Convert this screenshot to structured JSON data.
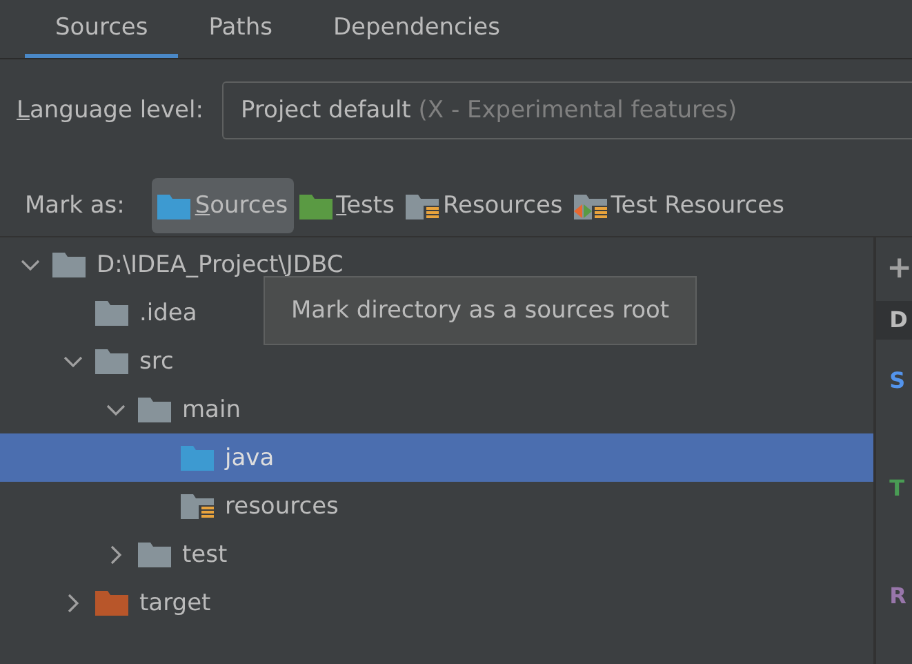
{
  "tabs": [
    {
      "label": "Sources",
      "selected": true
    },
    {
      "label": "Paths",
      "selected": false
    },
    {
      "label": "Dependencies",
      "selected": false
    }
  ],
  "language_level": {
    "label": "Language level:",
    "mnemonic": true,
    "value": "Project default",
    "hint": "(X - Experimental features)"
  },
  "mark_as": {
    "label": "Mark as:",
    "buttons": [
      {
        "label": "Sources",
        "kind": "sources",
        "mnemonic": true,
        "selected": true
      },
      {
        "label": "Tests",
        "kind": "tests",
        "mnemonic": true,
        "selected": false
      },
      {
        "label": "Resources",
        "kind": "resources",
        "mnemonic": false,
        "selected": false
      },
      {
        "label": "Test Resources",
        "kind": "test-resources",
        "mnemonic": false,
        "selected": false
      }
    ]
  },
  "tree": [
    {
      "name": "D:\\IDEA_Project\\JDBC",
      "kind": "plain",
      "expanded": true,
      "selected": false,
      "children": [
        {
          "name": ".idea",
          "kind": "plain",
          "selected": false
        },
        {
          "name": "src",
          "kind": "plain",
          "expanded": true,
          "selected": false,
          "children": [
            {
              "name": "main",
              "kind": "plain",
              "expanded": true,
              "selected": false,
              "children": [
                {
                  "name": "java",
                  "kind": "sources",
                  "selected": true
                },
                {
                  "name": "resources",
                  "kind": "resources",
                  "selected": false
                }
              ]
            },
            {
              "name": "test",
              "kind": "plain",
              "expanded": false,
              "selected": false
            }
          ]
        },
        {
          "name": "target",
          "kind": "excluded",
          "expanded": false,
          "selected": false
        }
      ]
    }
  ],
  "tooltip": "Mark directory as a sources root",
  "roots_panel": {
    "add": "+",
    "entries": [
      {
        "text": "D",
        "kind": "header"
      },
      {
        "text": "S",
        "kind": "sources"
      },
      {
        "text": "T",
        "kind": "tests"
      },
      {
        "text": "R",
        "kind": "resources"
      }
    ]
  }
}
